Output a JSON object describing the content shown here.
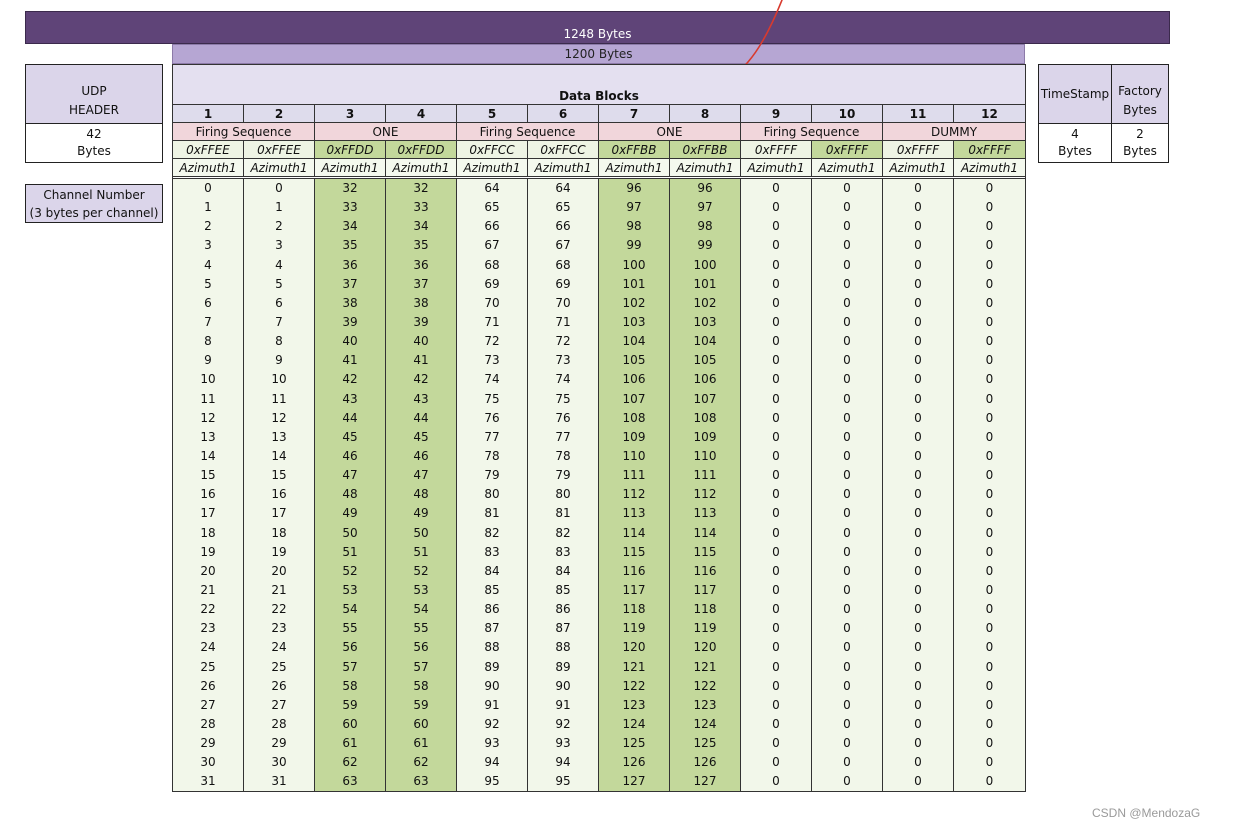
{
  "top_bar": {
    "label": "1248 Bytes"
  },
  "inner_bar": {
    "label": "1200 Bytes"
  },
  "udp": {
    "line1": "UDP",
    "line2": "HEADER",
    "size": "42",
    "unit": "Bytes"
  },
  "timestamp": {
    "title": "TimeStamp",
    "size": "4",
    "unit": "Bytes"
  },
  "factory": {
    "line1": "Factory",
    "line2": "Bytes",
    "size": "2",
    "unit": "Bytes"
  },
  "channel_box": {
    "line1": "Channel Number",
    "line2": "(3 bytes per channel)"
  },
  "data_blocks": {
    "title": "Data Blocks",
    "block_numbers": [
      "1",
      "2",
      "3",
      "4",
      "5",
      "6",
      "7",
      "8",
      "9",
      "10",
      "11",
      "12"
    ],
    "firing_groups": [
      {
        "left": "Firing Sequence",
        "right": "ONE"
      },
      {
        "left": "Firing Sequence",
        "right": "ONE"
      },
      {
        "left": "Firing Sequence",
        "right": "DUMMY"
      }
    ],
    "hex_flags": [
      "0xFFEE",
      "0xFFEE",
      "0xFFDD",
      "0xFFDD",
      "0xFFCC",
      "0xFFCC",
      "0xFFBB",
      "0xFFBB",
      "0xFFFF",
      "0xFFFF",
      "0xFFFF",
      "0xFFFF"
    ],
    "azimuth_labels": [
      "Azimuth1",
      "Azimuth1",
      "Azimuth1",
      "Azimuth1",
      "Azimuth1",
      "Azimuth1",
      "Azimuth1",
      "Azimuth1",
      "Azimuth1",
      "Azimuth1",
      "Azimuth1",
      "Azimuth1"
    ],
    "channel_offsets": [
      0,
      0,
      32,
      32,
      64,
      64,
      96,
      96,
      null,
      null,
      null,
      null
    ],
    "rows": 32,
    "dummy_value": "0"
  },
  "colors": {
    "top_bar": "#5f4478",
    "inner_bar": "#b6a6d3",
    "green": "#c3d89b",
    "pink": "#f1d6db"
  },
  "watermark": "CSDN @MendozaG"
}
